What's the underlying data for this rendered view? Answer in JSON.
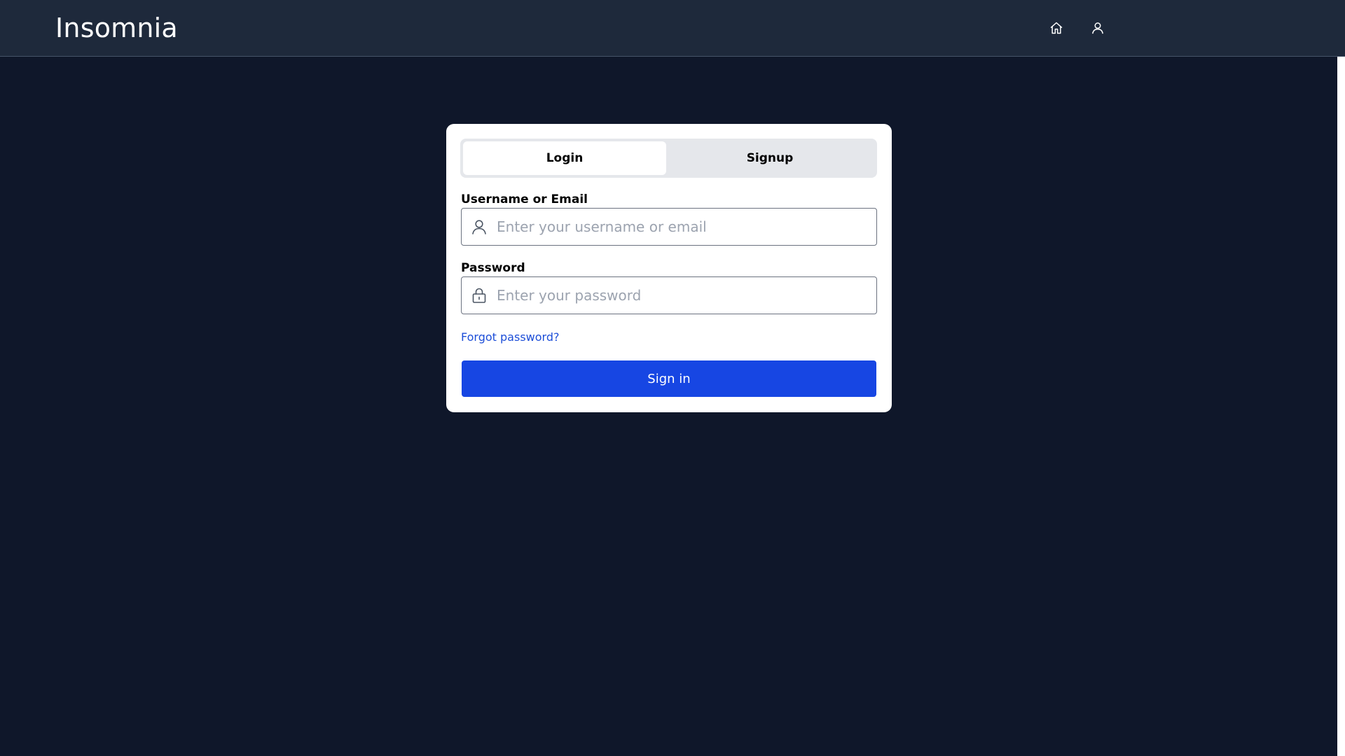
{
  "header": {
    "brand": "Insomnia",
    "icons": [
      "home-icon",
      "user-icon"
    ]
  },
  "auth": {
    "tabs": [
      {
        "label": "Login",
        "active": true
      },
      {
        "label": "Signup",
        "active": false
      }
    ],
    "username": {
      "label": "Username or Email",
      "placeholder": "Enter your username or email",
      "value": "",
      "icon": "user-icon"
    },
    "password": {
      "label": "Password",
      "placeholder": "Enter your password",
      "value": "",
      "icon": "lock-icon"
    },
    "forgot_label": "Forgot password?",
    "submit_label": "Sign in"
  },
  "colors": {
    "page_bg": "#0f172a",
    "navbar_bg": "#1e293b",
    "primary": "#1746e3",
    "link": "#1d4ed8",
    "tab_track": "#e5e7eb"
  }
}
